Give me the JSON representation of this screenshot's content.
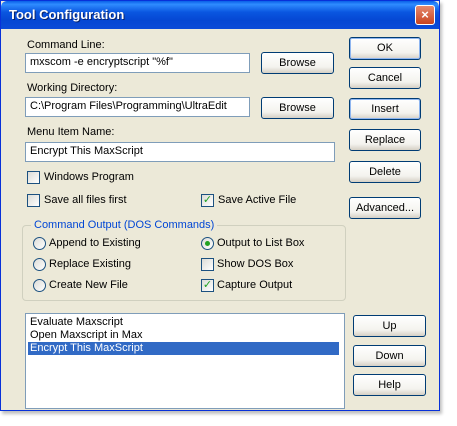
{
  "window": {
    "title": "Tool Configuration",
    "close_glyph": "×"
  },
  "command_line": {
    "label": "Command Line:",
    "value": "mxscom -e encryptscript \"%f\"",
    "browse": "Browse"
  },
  "working_directory": {
    "label": "Working Directory:",
    "value": "C:\\Program Files\\Programming\\UltraEdit",
    "browse": "Browse"
  },
  "menu_item_name": {
    "label": "Menu Item Name:",
    "value": "Encrypt This MaxScript"
  },
  "options": {
    "windows_program": {
      "label": "Windows Program",
      "checked": false
    },
    "save_all_files_first": {
      "label": "Save all files first",
      "checked": false
    },
    "save_active_file": {
      "label": "Save Active File",
      "checked": true
    }
  },
  "command_output": {
    "title": "Command Output (DOS Commands)",
    "append_to_existing": {
      "label": "Append to Existing",
      "selected": false
    },
    "replace_existing": {
      "label": "Replace Existing",
      "selected": false
    },
    "create_new_file": {
      "label": "Create New File",
      "selected": false
    },
    "output_to_list_box": {
      "label": "Output to List Box",
      "selected": true
    },
    "show_dos_box": {
      "label": "Show DOS Box",
      "checked": false
    },
    "capture_output": {
      "label": "Capture Output",
      "checked": true
    }
  },
  "buttons": {
    "ok": "OK",
    "cancel": "Cancel",
    "insert": "Insert",
    "replace": "Replace",
    "delete": "Delete",
    "advanced": "Advanced...",
    "up": "Up",
    "down": "Down",
    "help": "Help"
  },
  "tool_list": {
    "items": [
      "Evaluate Maxscript",
      "Open Maxscript in Max",
      "Encrypt This MaxScript"
    ],
    "selected_index": 2
  },
  "colors": {
    "title_bar": "#0a56e0",
    "selection": "#316ac5",
    "check_mark": "#21a121",
    "group_title": "#0046d5"
  }
}
